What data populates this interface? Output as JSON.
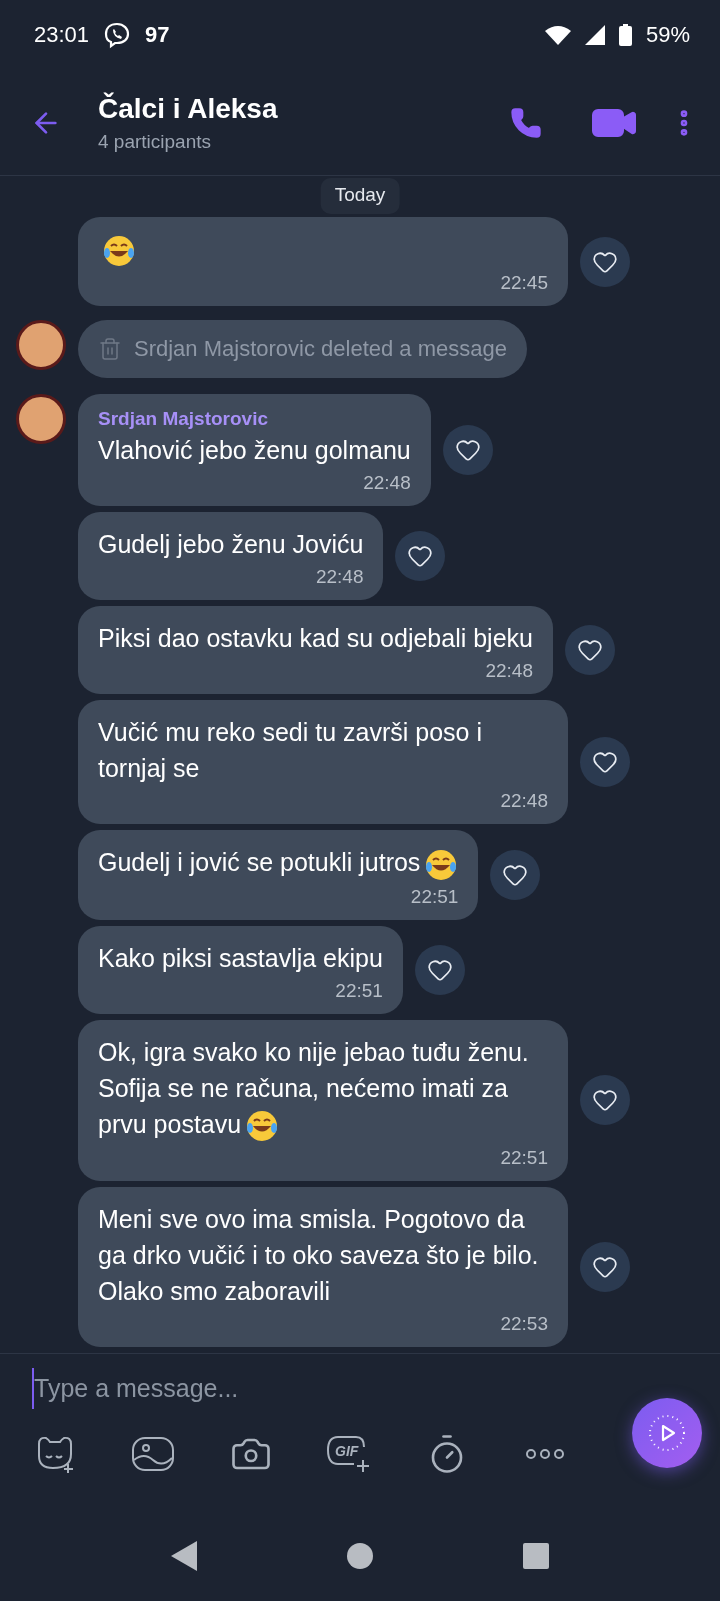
{
  "status_bar": {
    "time": "23:01",
    "notification_count": "97",
    "battery": "59%"
  },
  "header": {
    "title": "Čalci i Aleksa",
    "subtitle": "4 participants"
  },
  "date_pill": "Today",
  "messages": [
    {
      "kind": "text",
      "avatar": false,
      "emoji": true,
      "time": "22:45"
    },
    {
      "kind": "deleted",
      "avatar": true,
      "text": "Srdjan Majstorovic deleted a message"
    },
    {
      "kind": "text",
      "avatar": true,
      "sender": "Srdjan Majstorovic",
      "text": "Vlahović jebo ženu golmanu",
      "emoji": false,
      "time": "22:48"
    },
    {
      "kind": "text",
      "avatar": false,
      "text": "Gudelj jebo ženu Joviću",
      "emoji": false,
      "time": "22:48"
    },
    {
      "kind": "text",
      "avatar": false,
      "text": "Piksi dao ostavku kad su odjebali bjeku",
      "emoji": false,
      "time": "22:48"
    },
    {
      "kind": "text",
      "avatar": false,
      "text": "Vučić mu reko sedi tu završi poso i tornjaj se",
      "emoji": false,
      "time": "22:48"
    },
    {
      "kind": "text",
      "avatar": false,
      "text": "Gudelj i jović se potukli jutros",
      "emoji": true,
      "time": "22:51"
    },
    {
      "kind": "text",
      "avatar": false,
      "text": "Kako piksi sastavlja ekipu",
      "emoji": false,
      "time": "22:51"
    },
    {
      "kind": "text",
      "avatar": false,
      "text": "Ok, igra svako ko nije jebao tuđu ženu. Sofija se ne računa, nećemo imati za prvu postavu",
      "emoji": true,
      "time": "22:51"
    },
    {
      "kind": "text",
      "avatar": false,
      "text": "Meni sve ovo ima smisla. Pogotovo da ga drko vučić i to oko saveza što je bilo. Olako smo zaboravili",
      "emoji": false,
      "time": "22:53"
    }
  ],
  "composer": {
    "placeholder": "Type a message..."
  },
  "toolbar": [
    {
      "kind": "sticker"
    },
    {
      "kind": "gallery"
    },
    {
      "kind": "camera"
    },
    {
      "kind": "gif",
      "label": "GIF"
    },
    {
      "kind": "timer"
    },
    {
      "kind": "more"
    }
  ]
}
